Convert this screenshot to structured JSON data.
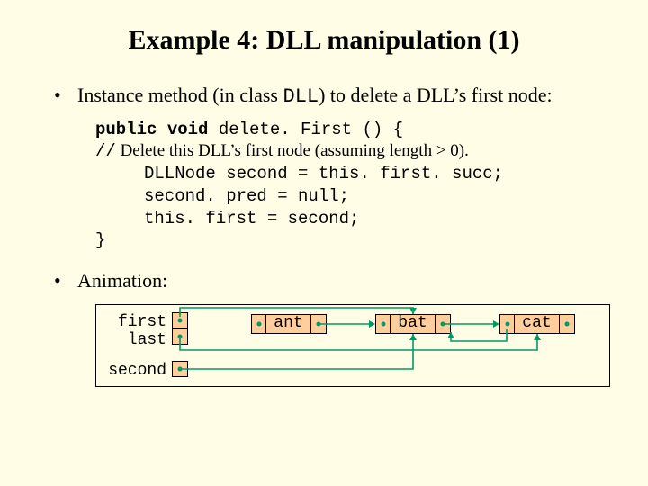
{
  "title": "Example 4: DLL manipulation (1)",
  "bullet1_a": "Instance method (in class ",
  "bullet1_dll": "DLL",
  "bullet1_b": ") to delete a DLL’s first node:",
  "code": {
    "l1a": "public void",
    "l1b": " delete. First () {",
    "l2a": "//",
    "l2b": " Delete this DLL’s first node (assuming length > 0).",
    "l3": "DLLNode second = this. first. succ;",
    "l4": "second. pred = null;",
    "l5": "this. first = second;",
    "l6": "}"
  },
  "bullet2": "Animation:",
  "diag": {
    "first": "first",
    "last": "last",
    "second": "second",
    "n1": "ant",
    "n2": "bat",
    "n3": "cat"
  }
}
